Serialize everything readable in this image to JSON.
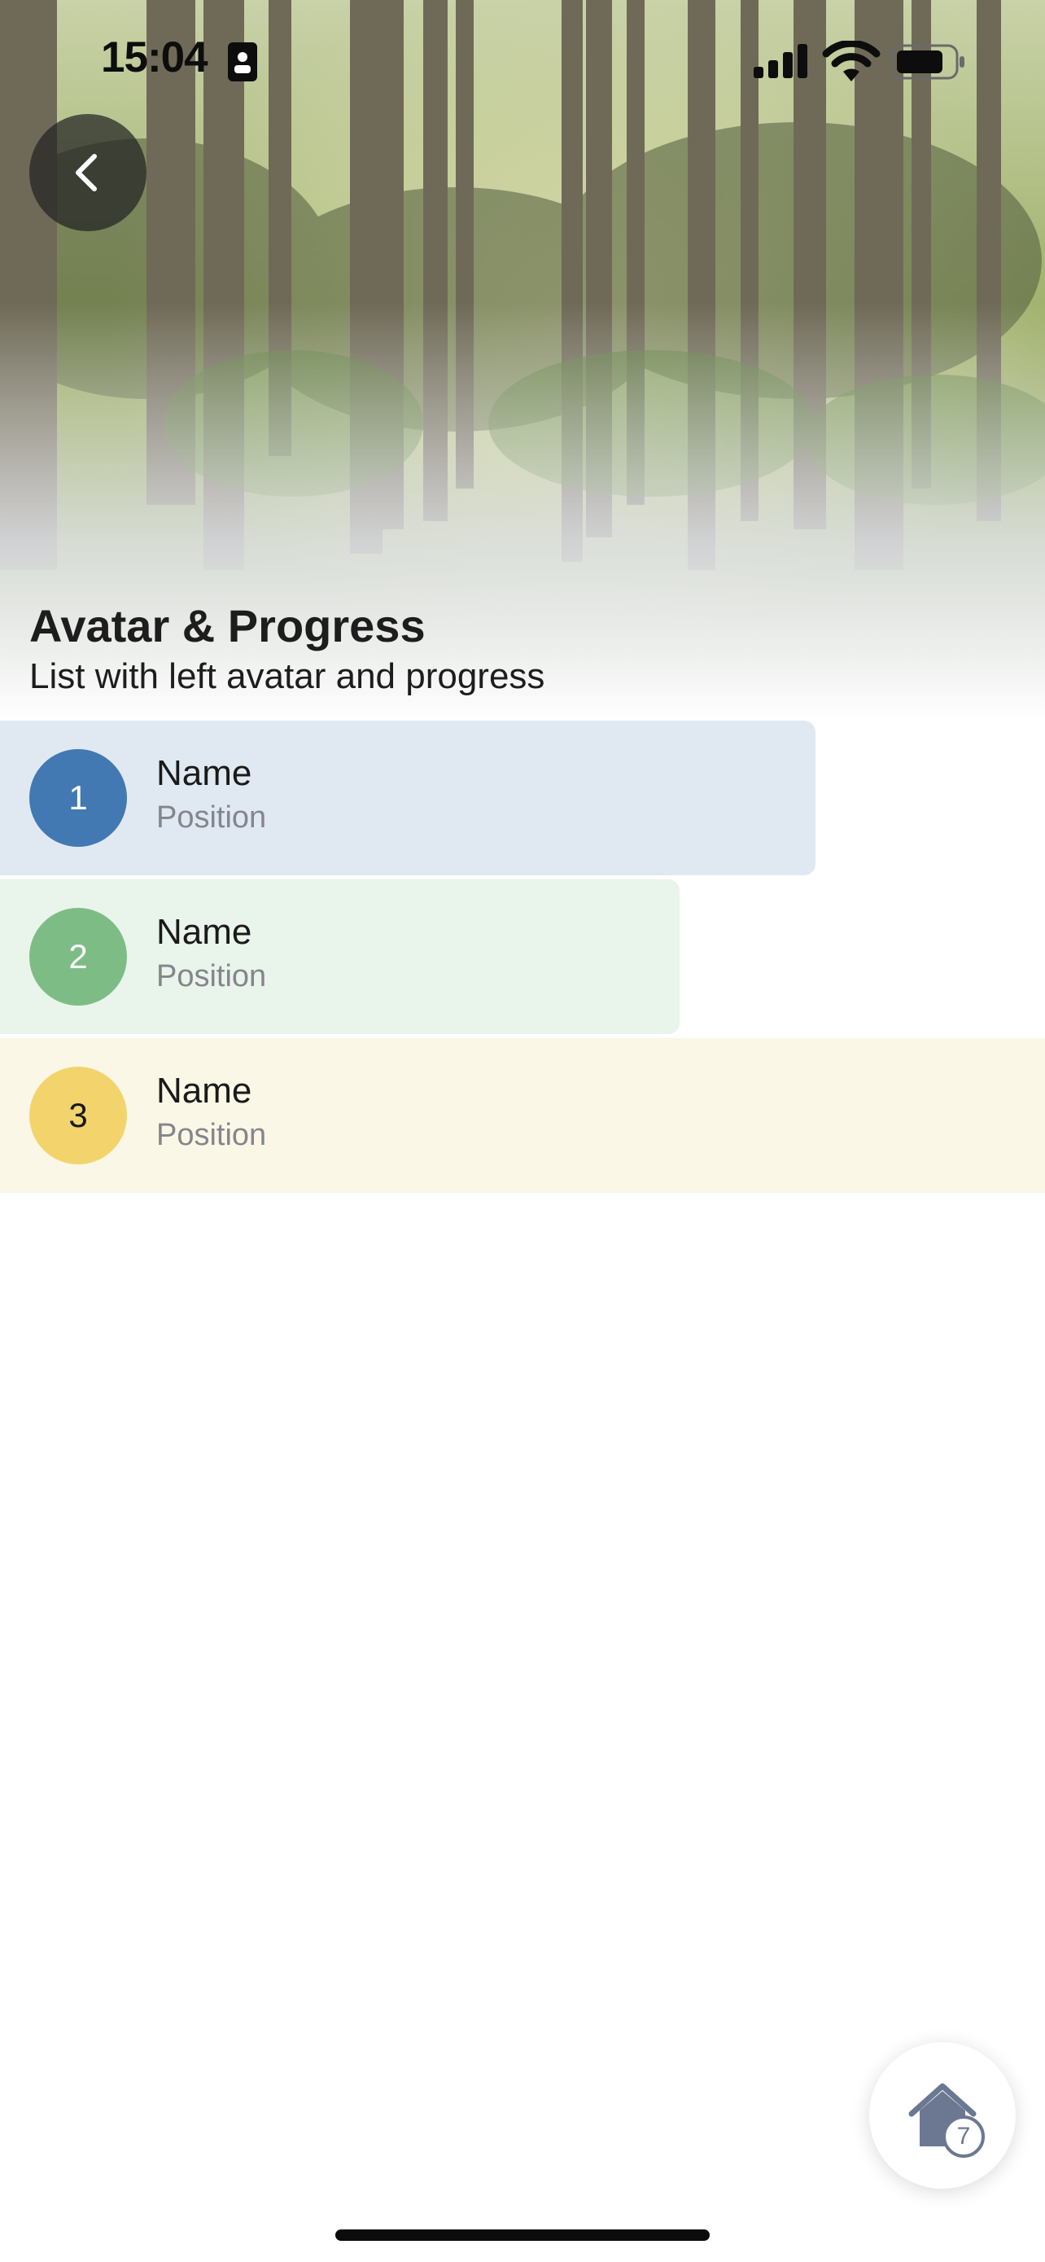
{
  "status_bar": {
    "time": "15:04"
  },
  "header": {
    "title": "Avatar & Progress",
    "subtitle": "List with left avatar and progress"
  },
  "list": {
    "items": [
      {
        "avatar": "1",
        "name": "Name",
        "position": "Position",
        "progress": 0.78,
        "color": "#4279b2",
        "tint": "#e0e9f2",
        "avatar_text_color": "#ffffff"
      },
      {
        "avatar": "2",
        "name": "Name",
        "position": "Position",
        "progress": 0.65,
        "color": "#7dbd85",
        "tint": "#e9f4eb",
        "avatar_text_color": "#ffffff"
      },
      {
        "avatar": "3",
        "name": "Name",
        "position": "Position",
        "progress": 1.0,
        "color": "#f3d46c",
        "tint": "#fbf7e6",
        "avatar_text_color": "#1a1a1a"
      }
    ]
  },
  "fab": {
    "icon": "home-icon",
    "badge": "7"
  },
  "colors": {
    "background": "#ffffff",
    "secondary_text": "#85858c"
  }
}
